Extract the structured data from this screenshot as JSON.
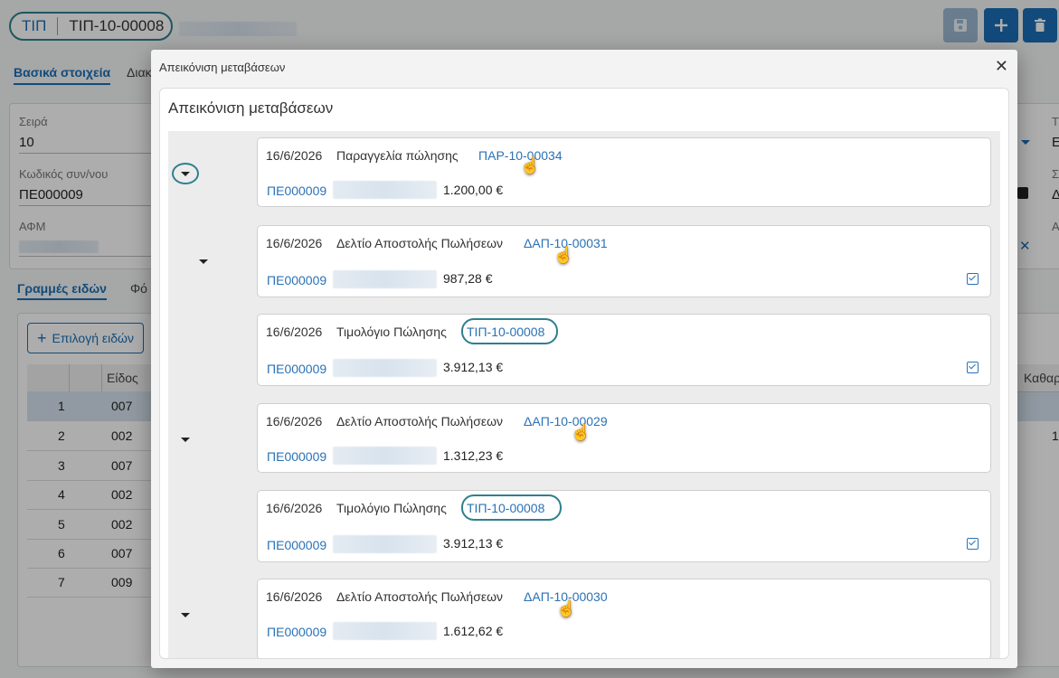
{
  "header": {
    "doc_type": "ΤΙΠ",
    "doc_number": "ΤΙΠ-10-00008",
    "tabs": [
      "Βασικά στοιχεία",
      "Διακ"
    ]
  },
  "form": {
    "series_label": "Σειρά",
    "series_value": "10",
    "customer_code_label": "Κωδικός συν/νου",
    "customer_code_value": "ΠΕ000009",
    "vat_label": "ΑΦΜ",
    "right_labels": [
      "Τ",
      "Ε",
      "Σ",
      "Δ",
      "Α"
    ]
  },
  "lines": {
    "tab_items": "Γραμμές ειδών",
    "tab_other": "Φό",
    "select_items_button": "Επιλογή ειδών",
    "col_item": "Είδος",
    "col_net": "Καθαρ",
    "rows": [
      {
        "n": "1",
        "code": "007"
      },
      {
        "n": "2",
        "code": "002"
      },
      {
        "n": "3",
        "code": "007"
      },
      {
        "n": "4",
        "code": "002"
      },
      {
        "n": "5",
        "code": "002"
      },
      {
        "n": "6",
        "code": "007"
      },
      {
        "n": "7",
        "code": "009"
      }
    ],
    "right_value_row2": "1"
  },
  "modal": {
    "title": "Απεικόνιση μεταβάσεων",
    "panel_title": "Απεικόνιση μεταβάσεων",
    "nodes": [
      {
        "date": "16/6/2026",
        "type": "Παραγγελία πώλησης",
        "link": "ΠΑΡ-10-00034",
        "customer": "ΠΕ000009",
        "amount": "1.200,00  €",
        "checked": false
      },
      {
        "date": "16/6/2026",
        "type": "Δελτίο Αποστολής Πωλήσεων",
        "link": "ΔΑΠ-10-00031",
        "customer": "ΠΕ000009",
        "amount": "987,28  €",
        "checked": true
      },
      {
        "date": "16/6/2026",
        "type": "Τιμολόγιο Πώλησης",
        "link": "ΤΙΠ-10-00008",
        "customer": "ΠΕ000009",
        "amount": "3.912,13  €",
        "checked": true
      },
      {
        "date": "16/6/2026",
        "type": "Δελτίο Αποστολής Πωλήσεων",
        "link": "ΔΑΠ-10-00029",
        "customer": "ΠΕ000009",
        "amount": "1.312,23  €",
        "checked": false
      },
      {
        "date": "16/6/2026",
        "type": "Τιμολόγιο Πώλησης",
        "link": "ΤΙΠ-10-00008",
        "customer": "ΠΕ000009",
        "amount": "3.912,13  €",
        "checked": true
      },
      {
        "date": "16/6/2026",
        "type": "Δελτίο Αποστολής Πωλήσεων",
        "link": "ΔΑΠ-10-00030",
        "customer": "ΠΕ000009",
        "amount": "1.612,62  €",
        "checked": false
      }
    ]
  },
  "colors": {
    "accent": "#1b6fb5",
    "highlight_ring": "#2f7f8e"
  },
  "icons": [
    "save-icon",
    "plus-icon",
    "trash-icon",
    "close-icon",
    "caret-down-icon",
    "checkbox-checked-icon",
    "hand-pointer-icon"
  ]
}
